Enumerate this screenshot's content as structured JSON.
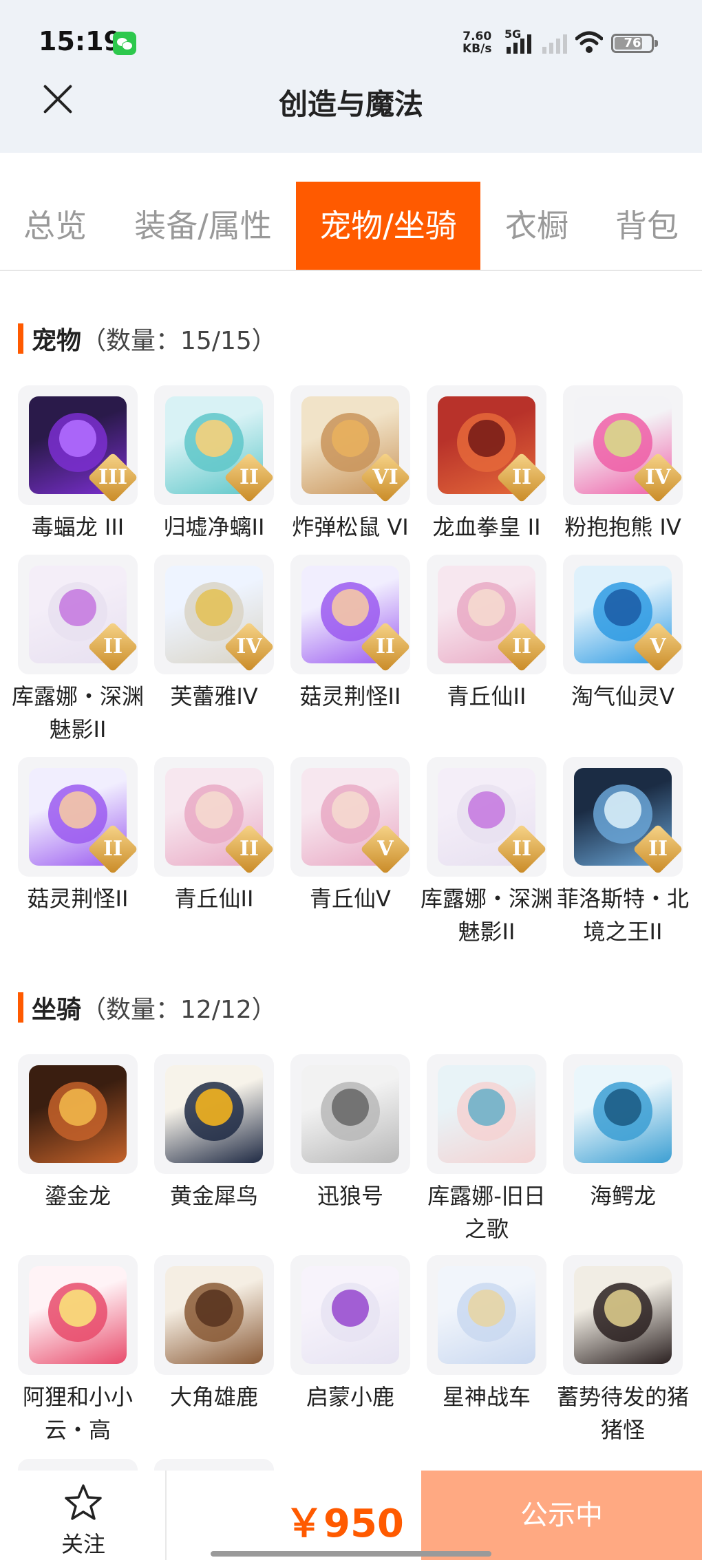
{
  "status_bar": {
    "time": "15:19",
    "net_speed_value": "7.60",
    "net_speed_unit": "KB/s",
    "network_type": "5G",
    "battery_level": "76",
    "icons": [
      "wechat-icon",
      "signal-icon",
      "wifi-icon",
      "battery-icon"
    ]
  },
  "header": {
    "title": "创造与魔法",
    "close_icon": "close-icon"
  },
  "tabs": [
    {
      "label": "总览",
      "active": false
    },
    {
      "label": "装备/属性",
      "active": false
    },
    {
      "label": "宠物/坐骑",
      "active": true
    },
    {
      "label": "衣橱",
      "active": false
    },
    {
      "label": "背包",
      "active": false
    }
  ],
  "pets": {
    "title": "宠物",
    "count": "（数量：15/15）",
    "items": [
      {
        "name": "毒蝠龙 III",
        "rank": "III",
        "colors": [
          "#2a1a4a",
          "#7b2fd0",
          "#b06bff"
        ]
      },
      {
        "name": "归墟净螭II",
        "rank": "II",
        "colors": [
          "#d8f2f5",
          "#5fc7c9",
          "#f5d07a"
        ]
      },
      {
        "name": "炸弹松鼠 VI",
        "rank": "VI",
        "colors": [
          "#f1e3c8",
          "#c9945a",
          "#e8b05e"
        ]
      },
      {
        "name": "龙血拳皇 II",
        "rank": "II",
        "colors": [
          "#b8322a",
          "#e5693a",
          "#7a1e18"
        ]
      },
      {
        "name": "粉抱抱熊 IV",
        "rank": "IV",
        "colors": [
          "#f3f3f6",
          "#ef5fa7",
          "#d7d88a"
        ]
      },
      {
        "name": "库露娜・深渊魅影II",
        "rank": "II",
        "colors": [
          "#f4eef8",
          "#e7e0f0",
          "#c77ce0"
        ]
      },
      {
        "name": "芙蕾雅IV",
        "rank": "IV",
        "colors": [
          "#eef4ff",
          "#d9d4c6",
          "#e3c25a"
        ]
      },
      {
        "name": "菇灵荆怪II",
        "rank": "II",
        "colors": [
          "#f1eefe",
          "#9b5bf0",
          "#f4c6a6"
        ]
      },
      {
        "name": "青丘仙II",
        "rank": "II",
        "colors": [
          "#f7e7ef",
          "#e9a9c4",
          "#f5d9cf"
        ]
      },
      {
        "name": "淘气仙灵V",
        "rank": "V",
        "colors": [
          "#dff1fb",
          "#2f9be3",
          "#1d5fa8"
        ]
      },
      {
        "name": "菇灵荆怪II",
        "rank": "II",
        "colors": [
          "#f1eefe",
          "#9b5bf0",
          "#f4c6a6"
        ]
      },
      {
        "name": "青丘仙II",
        "rank": "II",
        "colors": [
          "#f7e7ef",
          "#e9a9c4",
          "#f5d9cf"
        ]
      },
      {
        "name": "青丘仙V",
        "rank": "V",
        "colors": [
          "#f7e7ef",
          "#e9a9c4",
          "#f5d9cf"
        ]
      },
      {
        "name": "库露娜・深渊魅影II",
        "rank": "II",
        "colors": [
          "#f4eef8",
          "#e7e0f0",
          "#c77ce0"
        ]
      },
      {
        "name": "菲洛斯特・北境之王II",
        "rank": "II",
        "colors": [
          "#1b2c44",
          "#6aa5d6",
          "#d7ecf7"
        ]
      }
    ]
  },
  "mounts": {
    "title": "坐骑",
    "count": "（数量：12/12）",
    "items": [
      {
        "name": "鎏金龙",
        "colors": [
          "#3a1e10",
          "#c4622a",
          "#f0b54a"
        ]
      },
      {
        "name": "黄金犀鸟",
        "colors": [
          "#f7f3ea",
          "#1f2a44",
          "#f2b31f"
        ]
      },
      {
        "name": "迅狼号",
        "colors": [
          "#f2f2f2",
          "#b8b8b8",
          "#6a6a6a"
        ]
      },
      {
        "name": "库露娜-旧日之歌",
        "colors": [
          "#e8f3f7",
          "#f4d2d2",
          "#6fb1c9"
        ]
      },
      {
        "name": "海鳄龙",
        "colors": [
          "#eaf6fb",
          "#3c9fd3",
          "#1d5d86"
        ]
      },
      {
        "name": "阿狸和小小云・高",
        "colors": [
          "#fff3f6",
          "#e84b6b",
          "#f9e07a"
        ]
      },
      {
        "name": "大角雄鹿",
        "colors": [
          "#f5eee3",
          "#8a5a36",
          "#5a3520"
        ]
      },
      {
        "name": "启蒙小鹿",
        "colors": [
          "#f7f3fb",
          "#e6e3f2",
          "#9a4fd0"
        ]
      },
      {
        "name": "星神战车",
        "colors": [
          "#f1f5fb",
          "#c9d8f0",
          "#e7d5a5"
        ]
      },
      {
        "name": "蓄势待发的猪猪怪",
        "colors": [
          "#f1ede4",
          "#2a2020",
          "#d9c98a"
        ]
      }
    ]
  },
  "bottom_bar": {
    "follow_label": "关注",
    "follow_icon": "star-icon",
    "price": "￥950",
    "status_label": "公示中"
  }
}
